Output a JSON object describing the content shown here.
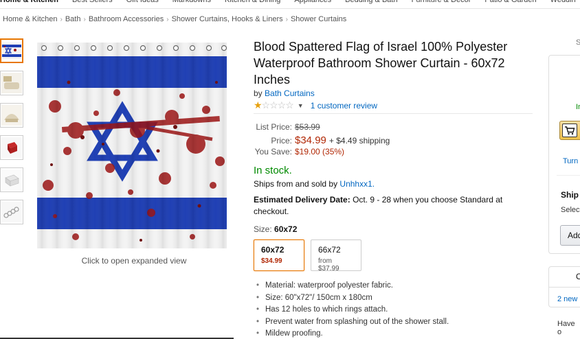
{
  "topnav": [
    "Home & Kitchen",
    "Best Sellers",
    "Gift Ideas",
    "Markdowns",
    "Kitchen & Dining",
    "Appliances",
    "Bedding & Bath",
    "Furniture & Decor",
    "Patio & Garden",
    "Weddin"
  ],
  "breadcrumb": [
    "Home & Kitchen",
    "Bath",
    "Bathroom Accessories",
    "Shower Curtains, Hooks & Liners",
    "Shower Curtains"
  ],
  "breadcrumb_sep": "›",
  "image": {
    "caption": "Click to open expanded view",
    "thumbnails": [
      "flag-thumb",
      "bath-thumb-1",
      "bath-thumb-2",
      "red-cube-thumb",
      "white-box-thumb",
      "rings-thumb"
    ]
  },
  "product": {
    "title": "Blood Spattered Flag of Israel 100% Polyester Waterproof Bathroom Shower Curtain - 60x72 Inches",
    "by_prefix": "by",
    "brand": "Bath Curtains",
    "rating_stars": 1,
    "rating_max": 5,
    "reviews": "1 customer review",
    "list_price_label": "List Price:",
    "list_price": "$53.99",
    "price_label": "Price:",
    "price": "$34.99",
    "shipping": "+ $4.49 shipping",
    "save_label": "You Save:",
    "save": "$19.00 (35%)",
    "stock": "In stock.",
    "ships_from_prefix": "Ships from and sold by",
    "seller": "Unhhxx1.",
    "delivery_label": "Estimated Delivery Date:",
    "delivery_text": "Oct. 9 - 28 when you choose Standard at checkout.",
    "size_label": "Size:",
    "size_selected": "60x72",
    "size_options": [
      {
        "name": "60x72",
        "price": "$34.99"
      },
      {
        "name": "66x72",
        "price": "from $37.99"
      }
    ],
    "bullets": [
      "Material: waterproof polyester fabric.",
      "Size: 60\"x72\"/ 150cm x 180cm",
      "Has 12 holes to which rings attach.",
      "Prevent water from splashing out of the shower stall.",
      "Mildew proofing."
    ]
  },
  "buybox": {
    "s_text": "S",
    "in_text": "In",
    "turn_text": "Turn",
    "ship_heading": "Ship",
    "select_text": "Selec",
    "add_text": "Add",
    "other_heading": "O",
    "new_text": "2 new",
    "have_text": "Have o"
  },
  "colors": {
    "link": "#0066c0",
    "price": "#b12704",
    "stock": "#008a00",
    "star": "#e7a10e",
    "flag_blue": "#1f3fb4",
    "blood": "#9b1212"
  }
}
